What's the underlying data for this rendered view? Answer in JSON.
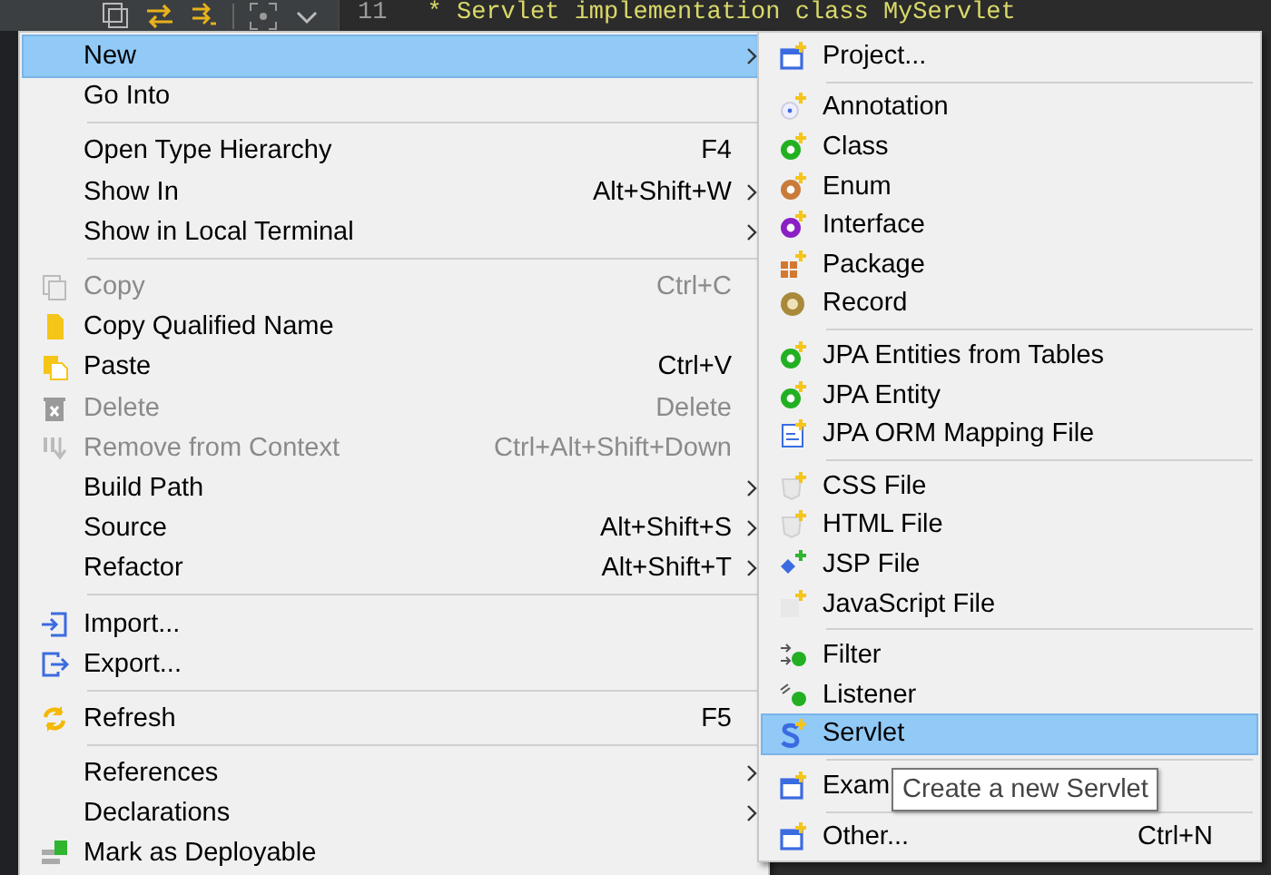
{
  "editor": {
    "line_number": "11",
    "code_line": " * Servlet implementation class MyServlet"
  },
  "context_menu": {
    "items": [
      {
        "kind": "item",
        "label": "New",
        "submenu": true,
        "selected": true,
        "disabled": false
      },
      {
        "kind": "item",
        "label": "Go Into",
        "selected": false,
        "disabled": false
      },
      {
        "kind": "separator"
      },
      {
        "kind": "item",
        "label": "Open Type Hierarchy",
        "shortcut": "F4",
        "selected": false,
        "disabled": false
      },
      {
        "kind": "item",
        "label": "Show In",
        "shortcut": "Alt+Shift+W",
        "submenu": true,
        "selected": false,
        "disabled": false
      },
      {
        "kind": "item",
        "label": "Show in Local Terminal",
        "submenu": true,
        "selected": false,
        "disabled": false
      },
      {
        "kind": "separator"
      },
      {
        "kind": "item",
        "label": "Copy",
        "shortcut": "Ctrl+C",
        "selected": false,
        "disabled": true
      },
      {
        "kind": "item",
        "label": "Copy Qualified Name",
        "selected": false,
        "disabled": false
      },
      {
        "kind": "item",
        "label": "Paste",
        "shortcut": "Ctrl+V",
        "selected": false,
        "disabled": false
      },
      {
        "kind": "item",
        "label": "Delete",
        "shortcut": "Delete",
        "selected": false,
        "disabled": true
      },
      {
        "kind": "item",
        "label": "Remove from Context",
        "shortcut": "Ctrl+Alt+Shift+Down",
        "selected": false,
        "disabled": true
      },
      {
        "kind": "item",
        "label": "Build Path",
        "submenu": true,
        "selected": false,
        "disabled": false
      },
      {
        "kind": "item",
        "label": "Source",
        "shortcut": "Alt+Shift+S",
        "submenu": true,
        "selected": false,
        "disabled": false
      },
      {
        "kind": "item",
        "label": "Refactor",
        "shortcut": "Alt+Shift+T",
        "submenu": true,
        "selected": false,
        "disabled": false
      },
      {
        "kind": "separator"
      },
      {
        "kind": "item",
        "label": "Import...",
        "selected": false,
        "disabled": false
      },
      {
        "kind": "item",
        "label": "Export...",
        "selected": false,
        "disabled": false
      },
      {
        "kind": "separator"
      },
      {
        "kind": "item",
        "label": "Refresh",
        "shortcut": "F5",
        "selected": false,
        "disabled": false
      },
      {
        "kind": "separator"
      },
      {
        "kind": "item",
        "label": "References",
        "submenu": true,
        "selected": false,
        "disabled": false
      },
      {
        "kind": "item",
        "label": "Declarations",
        "submenu": true,
        "selected": false,
        "disabled": false
      },
      {
        "kind": "item",
        "label": "Mark as Deployable",
        "selected": false,
        "disabled": false
      }
    ]
  },
  "new_submenu": {
    "items": [
      {
        "kind": "item",
        "label": "Project...",
        "selected": false
      },
      {
        "kind": "separator"
      },
      {
        "kind": "item",
        "label": "Annotation",
        "selected": false
      },
      {
        "kind": "item",
        "label": "Class",
        "selected": false
      },
      {
        "kind": "item",
        "label": "Enum",
        "selected": false
      },
      {
        "kind": "item",
        "label": "Interface",
        "selected": false
      },
      {
        "kind": "item",
        "label": "Package",
        "selected": false
      },
      {
        "kind": "item",
        "label": "Record",
        "selected": false
      },
      {
        "kind": "separator"
      },
      {
        "kind": "item",
        "label": "JPA Entities from Tables",
        "selected": false
      },
      {
        "kind": "item",
        "label": "JPA Entity",
        "selected": false
      },
      {
        "kind": "item",
        "label": "JPA ORM Mapping File",
        "selected": false
      },
      {
        "kind": "separator"
      },
      {
        "kind": "item",
        "label": "CSS File",
        "selected": false
      },
      {
        "kind": "item",
        "label": "HTML File",
        "selected": false
      },
      {
        "kind": "item",
        "label": "JSP File",
        "selected": false
      },
      {
        "kind": "item",
        "label": "JavaScript File",
        "selected": false
      },
      {
        "kind": "separator"
      },
      {
        "kind": "item",
        "label": "Filter",
        "selected": false
      },
      {
        "kind": "item",
        "label": "Listener",
        "selected": false
      },
      {
        "kind": "item",
        "label": "Servlet",
        "selected": true
      },
      {
        "kind": "separator"
      },
      {
        "kind": "item",
        "label": "Exam",
        "selected": false
      },
      {
        "kind": "separator"
      },
      {
        "kind": "item",
        "label": "Other...",
        "shortcut": "Ctrl+N",
        "selected": false
      }
    ]
  },
  "tooltip": {
    "text": "Create a new Servlet"
  }
}
